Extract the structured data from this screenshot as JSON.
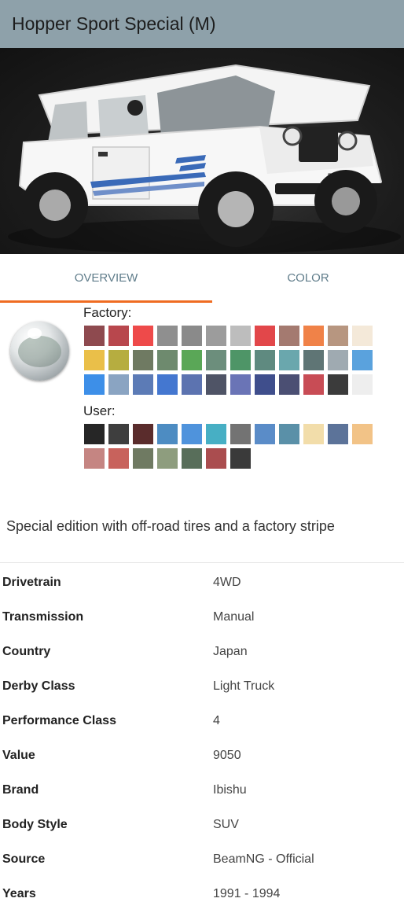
{
  "vehicle": {
    "title": "Hopper Sport Special (M)"
  },
  "tabs": [
    {
      "label": "OVERVIEW"
    },
    {
      "label": "COLOR"
    }
  ],
  "colors": {
    "factory_label": "Factory:",
    "user_label": "User:",
    "factory": [
      "#8e4a4f",
      "#b8474d",
      "#ee4a4a",
      "#8f8f8f",
      "#8a8a8a",
      "#9c9c9c",
      "#bdbdbd",
      "#e2474a",
      "#a47a70",
      "#f08248",
      "#b79680",
      "#f4e9d9",
      "#eabf49",
      "#b6ad40",
      "#6f7a62",
      "#6e8a6e",
      "#5aa757",
      "#6c8e7c",
      "#4e9567",
      "#5f8a80",
      "#6aa7ad",
      "#5f7575",
      "#9faab1",
      "#5aa2dd",
      "#3d8fe8",
      "#8aa4c2",
      "#5c7bb6",
      "#4477d0",
      "#5c73b0",
      "#4f5466",
      "#6a74b6",
      "#3f4e8c",
      "#4b4f73",
      "#c84c55",
      "#3b3b3b",
      "#eeeeee"
    ],
    "user": [
      "#262626",
      "#3e3e3e",
      "#5a2c2c",
      "#4d8cc2",
      "#4f93dc",
      "#47afc4",
      "#737373",
      "#5a8cc8",
      "#5a90a8",
      "#f2ddaa",
      "#5c7399",
      "#f2c387",
      "#c58582",
      "#c8625c",
      "#6f7a62",
      "#8e9d7e",
      "#586e5a",
      "#aa4d4f",
      "#3a3a3a"
    ]
  },
  "description": "Special edition with off-road tires and a factory stripe",
  "specs": [
    {
      "label": "Drivetrain",
      "value": "4WD"
    },
    {
      "label": "Transmission",
      "value": "Manual"
    },
    {
      "label": "Country",
      "value": "Japan"
    },
    {
      "label": "Derby Class",
      "value": "Light Truck"
    },
    {
      "label": "Performance Class",
      "value": "4"
    },
    {
      "label": "Value",
      "value": "9050"
    },
    {
      "label": "Brand",
      "value": "Ibishu"
    },
    {
      "label": "Body Style",
      "value": "SUV"
    },
    {
      "label": "Source",
      "value": "BeamNG - Official"
    },
    {
      "label": "Years",
      "value": "1991 - 1994"
    }
  ]
}
